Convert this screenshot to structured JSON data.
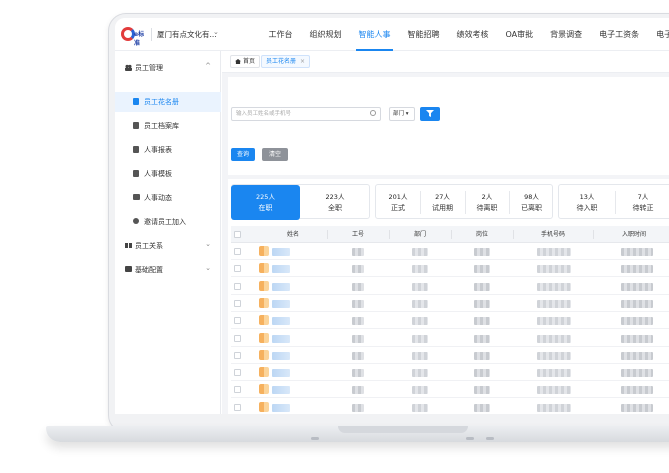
{
  "topbar": {
    "logo_text": "e标准",
    "company": "厦门有点文化有...",
    "caret": "⌄",
    "nav": [
      {
        "label": "工作台",
        "active": false
      },
      {
        "label": "组织规划",
        "active": false
      },
      {
        "label": "智能人事",
        "active": true
      },
      {
        "label": "智能招聘",
        "active": false
      },
      {
        "label": "绩效考核",
        "active": false
      },
      {
        "label": "OA审批",
        "active": false
      },
      {
        "label": "背景调查",
        "active": false
      },
      {
        "label": "电子工资条",
        "active": false
      },
      {
        "label": "电子合同",
        "active": false
      }
    ]
  },
  "sidebar": {
    "groups": [
      {
        "label": "员工管理",
        "icon": "people-icon",
        "chevron": "^"
      },
      {
        "label": "员工关系",
        "icon": "relation-icon",
        "chevron": "⌄"
      },
      {
        "label": "基础配置",
        "icon": "settings-icon",
        "chevron": "⌄"
      }
    ],
    "items": [
      {
        "label": "员工花名册",
        "active": true
      },
      {
        "label": "员工档案库",
        "active": false
      },
      {
        "label": "人事报表",
        "active": false
      },
      {
        "label": "人事模板",
        "active": false
      },
      {
        "label": "人事动态",
        "active": false
      },
      {
        "label": "邀请员工加入",
        "active": false
      }
    ]
  },
  "tabs": {
    "home": "首页",
    "current": "员工花名册",
    "close": "×"
  },
  "filters": {
    "search_placeholder": "输入员工姓名或手机号",
    "dept_label": "部门 ▾",
    "query_label": "查询",
    "reset_label": "清空"
  },
  "stats": [
    {
      "num": "225人",
      "label": "在职"
    },
    {
      "num": "223人",
      "label": "全职"
    },
    {
      "num": "201人",
      "label": "正式"
    },
    {
      "num": "27人",
      "label": "试用期"
    },
    {
      "num": "2人",
      "label": "待离职"
    },
    {
      "num": "98人",
      "label": "已离职"
    },
    {
      "num": "13人",
      "label": "待入职"
    },
    {
      "num": "7人",
      "label": "待转正"
    }
  ],
  "table": {
    "columns": [
      "姓名",
      "工号",
      "部门",
      "岗位",
      "手机号码",
      "入职时间"
    ]
  },
  "colors": {
    "accent": "#1a86f0",
    "reset_button": "#8e9299"
  }
}
